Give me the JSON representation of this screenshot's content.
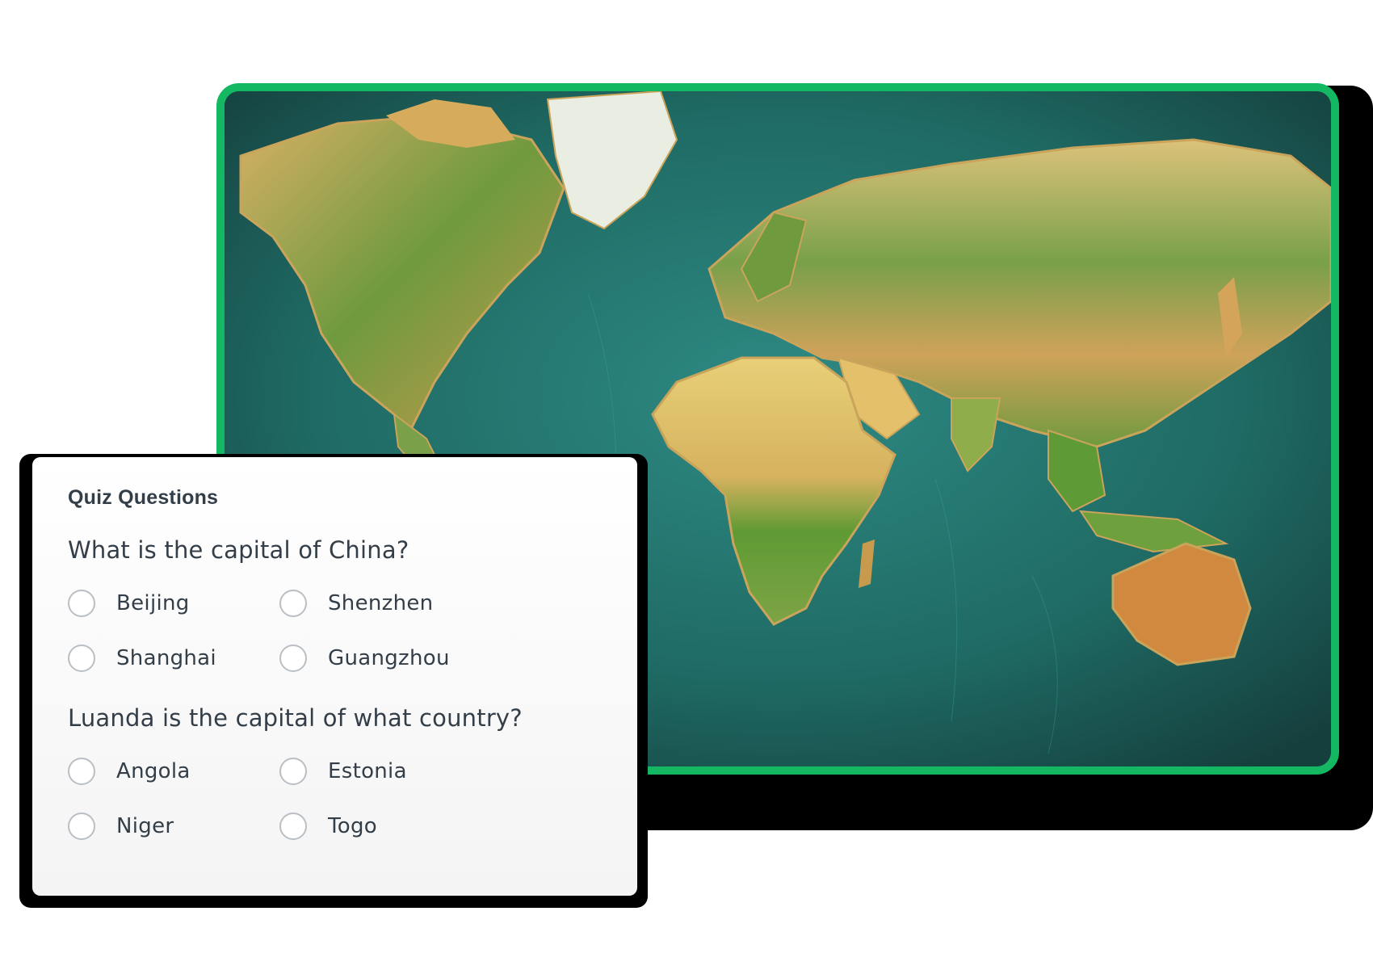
{
  "colors": {
    "accent_border": "#14b863",
    "text": "#333e48",
    "radio_border": "#b9bfc4",
    "ocean": "#1c5a56",
    "land_green": "#4f8f3a",
    "land_tan": "#d3a45a",
    "land_sand": "#e8cf78",
    "ice": "#e9ede2"
  },
  "map": {
    "image": "world-relief-map"
  },
  "quiz": {
    "heading": "Quiz Questions",
    "questions": [
      {
        "text": "What is the capital of China?",
        "options": [
          "Beijing",
          "Shenzhen",
          "Shanghai",
          "Guangzhou"
        ]
      },
      {
        "text": "Luanda is the capital of what country?",
        "options": [
          "Angola",
          "Estonia",
          "Niger",
          "Togo"
        ]
      }
    ]
  }
}
